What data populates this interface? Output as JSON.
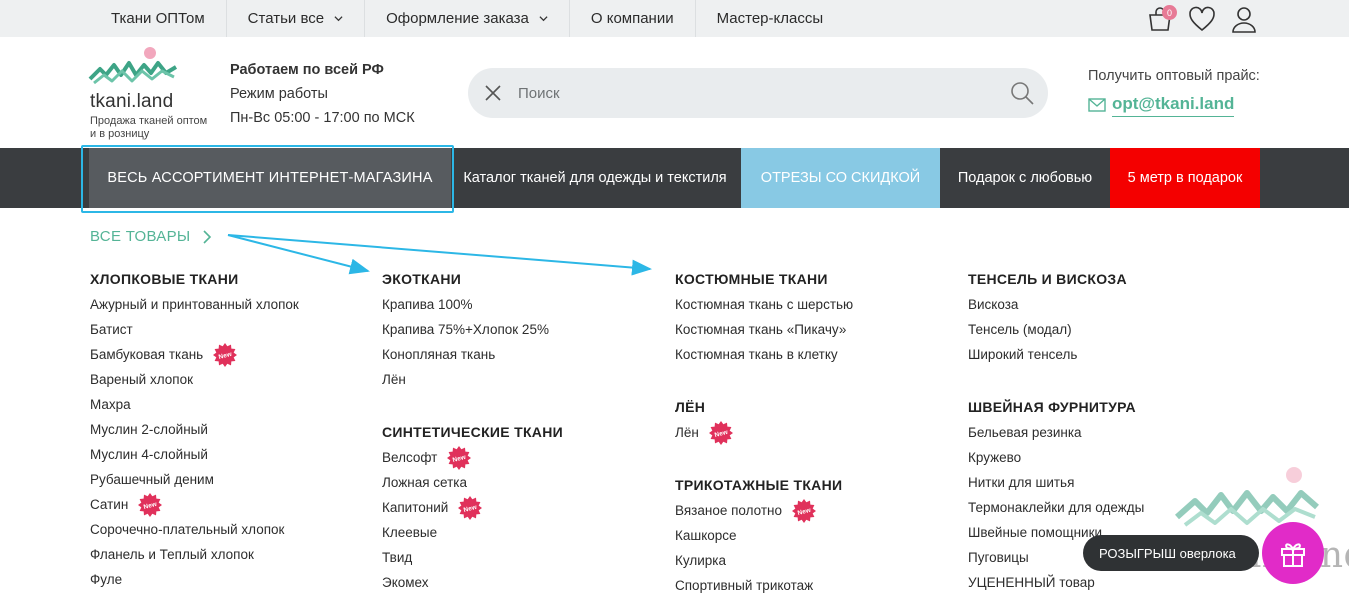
{
  "topnav": {
    "items": [
      {
        "label": "Ткани ОПТом",
        "dropdown": false
      },
      {
        "label": "Статьи все",
        "dropdown": true
      },
      {
        "label": "Оформление заказа",
        "dropdown": true
      },
      {
        "label": "О компании",
        "dropdown": false
      },
      {
        "label": "Мастер-классы",
        "dropdown": false
      }
    ],
    "cart_count": "0"
  },
  "header": {
    "logo_name": "tkani.land",
    "logo_tagline": "Продажа тканей оптом и в розницу",
    "work_title": "Работаем по всей РФ",
    "work_mode": "Режим работы",
    "work_hours": "Пн-Вс 05:00 - 17:00 по МСК",
    "search_placeholder": "Поиск",
    "price_label": "Получить оптовый прайс:",
    "email": "opt@tkani.land"
  },
  "mainmenu": {
    "all": "ВЕСЬ АССОРТИМЕНТ ИНТЕРНЕТ-МАГАЗИНА",
    "catalog": "Каталог тканей для одежды и текстиля",
    "cuts": "ОТРЕЗЫ СО СКИДКОЙ",
    "gift": "Подарок с любовью",
    "promo": "5 метр в подарок"
  },
  "all_goods": "ВСЕ ТОВАРЫ",
  "new_badge": "New",
  "columns": [
    {
      "groups": [
        {
          "title": "ХЛОПКОВЫЕ ТКАНИ",
          "items": [
            {
              "label": "Ажурный и принтованный хлопок",
              "new": false
            },
            {
              "label": "Батист",
              "new": false
            },
            {
              "label": "Бамбуковая ткань",
              "new": true
            },
            {
              "label": "Вареный хлопок",
              "new": false
            },
            {
              "label": "Махра",
              "new": false
            },
            {
              "label": "Муслин 2-слойный",
              "new": false
            },
            {
              "label": "Муслин 4-слойный",
              "new": false
            },
            {
              "label": "Рубашечный деним",
              "new": false
            },
            {
              "label": "Сатин",
              "new": true
            },
            {
              "label": "Сорочечно-плательный хлопок",
              "new": false
            },
            {
              "label": "Фланель и Теплый хлопок",
              "new": false
            },
            {
              "label": "Фуле",
              "new": false
            }
          ]
        }
      ]
    },
    {
      "groups": [
        {
          "title": "ЭКОТКАНИ",
          "items": [
            {
              "label": "Крапива 100%",
              "new": false
            },
            {
              "label": "Крапива 75%+Хлопок 25%",
              "new": false
            },
            {
              "label": "Конопляная ткань",
              "new": false
            },
            {
              "label": "Лён",
              "new": false
            }
          ]
        },
        {
          "title": "СИНТЕТИЧЕСКИЕ ТКАНИ",
          "items": [
            {
              "label": "Велсофт",
              "new": true
            },
            {
              "label": "Ложная сетка",
              "new": false
            },
            {
              "label": "Капитоний",
              "new": true
            },
            {
              "label": "Клеевые",
              "new": false
            },
            {
              "label": "Твид",
              "new": false
            },
            {
              "label": "Экомех",
              "new": false
            }
          ]
        }
      ]
    },
    {
      "groups": [
        {
          "title": "КОСТЮМНЫЕ ТКАНИ",
          "items": [
            {
              "label": "Костюмная ткань с шерстью",
              "new": false
            },
            {
              "label": "Костюмная ткань «Пикачу»",
              "new": false
            },
            {
              "label": "Костюмная ткань в клетку",
              "new": false
            }
          ]
        },
        {
          "title": "ЛЁН",
          "items": [
            {
              "label": "Лён",
              "new": true
            }
          ]
        },
        {
          "title": "ТРИКОТАЖНЫЕ ТКАНИ",
          "items": [
            {
              "label": "Вязаное полотно",
              "new": true
            },
            {
              "label": "Кашкорсе",
              "new": false
            },
            {
              "label": "Кулирка",
              "new": false
            },
            {
              "label": "Спортивный трикотаж",
              "new": false
            }
          ]
        }
      ]
    },
    {
      "groups": [
        {
          "title": "ТЕНСЕЛЬ И ВИСКОЗА",
          "items": [
            {
              "label": "Вискоза",
              "new": false
            },
            {
              "label": "Тенсель (модал)",
              "new": false
            },
            {
              "label": "Широкий тенсель",
              "new": false
            }
          ]
        },
        {
          "title": "ШВЕЙНАЯ ФУРНИТУРА",
          "items": [
            {
              "label": "Бельевая резинка",
              "new": false
            },
            {
              "label": "Кружево",
              "new": false
            },
            {
              "label": "Нитки для шитья",
              "new": false
            },
            {
              "label": "Термонаклейки для одежды",
              "new": false
            },
            {
              "label": "Швейные помощники",
              "new": false
            },
            {
              "label": "Пуговицы",
              "new": false
            },
            {
              "label": "УЦЕНЕННЫЙ товар",
              "new": false
            }
          ]
        }
      ]
    }
  ],
  "raffle": "РОЗЫГРЫШ оверлока",
  "watermark": "tkani.land",
  "colors": {
    "accent_green": "#54b496",
    "menu_dark": "#3a3d40",
    "menu_active": "#575b5f",
    "cuts_blue": "#88c9e4",
    "promo_red": "#f40000",
    "highlight_cyan": "#2cb7e6",
    "badge_pink": "#e0315b",
    "gift_magenta": "#e12bc8"
  }
}
